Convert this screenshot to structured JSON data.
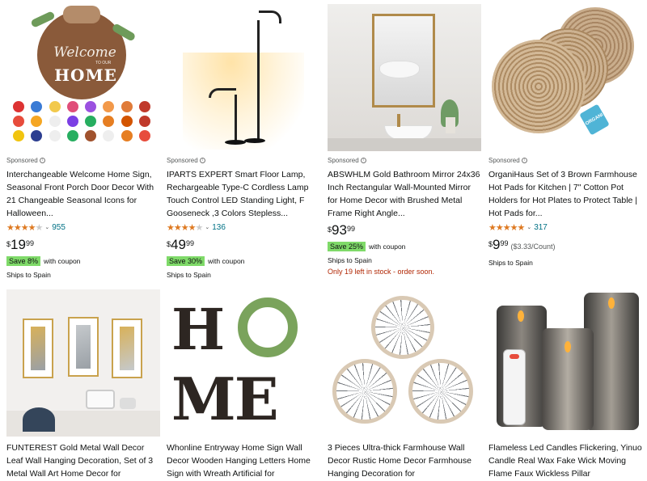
{
  "products": [
    {
      "sponsored": "Sponsored",
      "title": "Interchangeable Welcome Home Sign, Seasonal Front Porch Door Decor With 21 Changeable Seasonal Icons for Halloween...",
      "rating": 4.5,
      "stars": "★★★★★",
      "reviews": "955",
      "price_symbol": "$",
      "price_whole": "19",
      "price_fraction": "99",
      "coupon": "Save 8%",
      "coupon_text": "with coupon",
      "ships": "Ships to Spain",
      "image_text": {
        "welcome": "Welcome",
        "to_our": "TO OUR",
        "home": "HOME"
      }
    },
    {
      "sponsored": "Sponsored",
      "title": "IPARTS EXPERT Smart Floor Lamp, Rechargeable Type-C Cordless Lamp Touch Control LED Standing Light, F Gooseneck ,3 Colors Stepless...",
      "rating": 3.5,
      "stars": "★★★★★",
      "reviews": "136",
      "price_symbol": "$",
      "price_whole": "49",
      "price_fraction": "99",
      "coupon": "Save 30%",
      "coupon_text": "with coupon",
      "ships": "Ships to Spain"
    },
    {
      "sponsored": "Sponsored",
      "title": "ABSWHLM Gold Bathroom Mirror 24x36 Inch Rectangular Wall-Mounted Mirror for Home Decor with Brushed Metal Frame Right Angle...",
      "price_symbol": "$",
      "price_whole": "93",
      "price_fraction": "99",
      "coupon": "Save 25%",
      "coupon_text": "with coupon",
      "ships": "Ships to Spain",
      "stock": "Only 19 left in stock - order soon."
    },
    {
      "sponsored": "Sponsored",
      "title": "OrganiHaus Set of 3 Brown Farmhouse Hot Pads for Kitchen | 7\" Cotton Pot Holders for Hot Plates to Protect Table | Hot Pads for...",
      "rating": 5,
      "stars": "★★★★★",
      "reviews": "317",
      "price_symbol": "$",
      "price_whole": "9",
      "price_fraction": "99",
      "unit_price": "($3.33/Count)",
      "ships": "Ships to Spain",
      "image_text": {
        "tag": "ORGANI"
      }
    },
    {
      "title": "FUNTEREST Gold Metal Wall Decor Leaf Wall Hanging Decoration, Set of 3 Metal Wall Art Home Decor for"
    },
    {
      "title": "Whonline Entryway Home Sign Wall Decor Wooden Hanging Letters Home Sign with Wreath Artificial for",
      "image_text": {
        "h": "H",
        "me": "ME"
      }
    },
    {
      "title": "3 Pieces Ultra-thick Farmhouse Wall Decor Rustic Home Decor Farmhouse Hanging Decoration for"
    },
    {
      "title": "Flameless Led Candles Flickering, Yinuo Candle Real Wax Fake Wick Moving Flame Faux Wickless Pillar"
    }
  ],
  "colors": {
    "star": "#de7921",
    "link": "#007185",
    "coupon_bg": "#7fda69",
    "stock_red": "#b12704",
    "muted": "#565959"
  }
}
